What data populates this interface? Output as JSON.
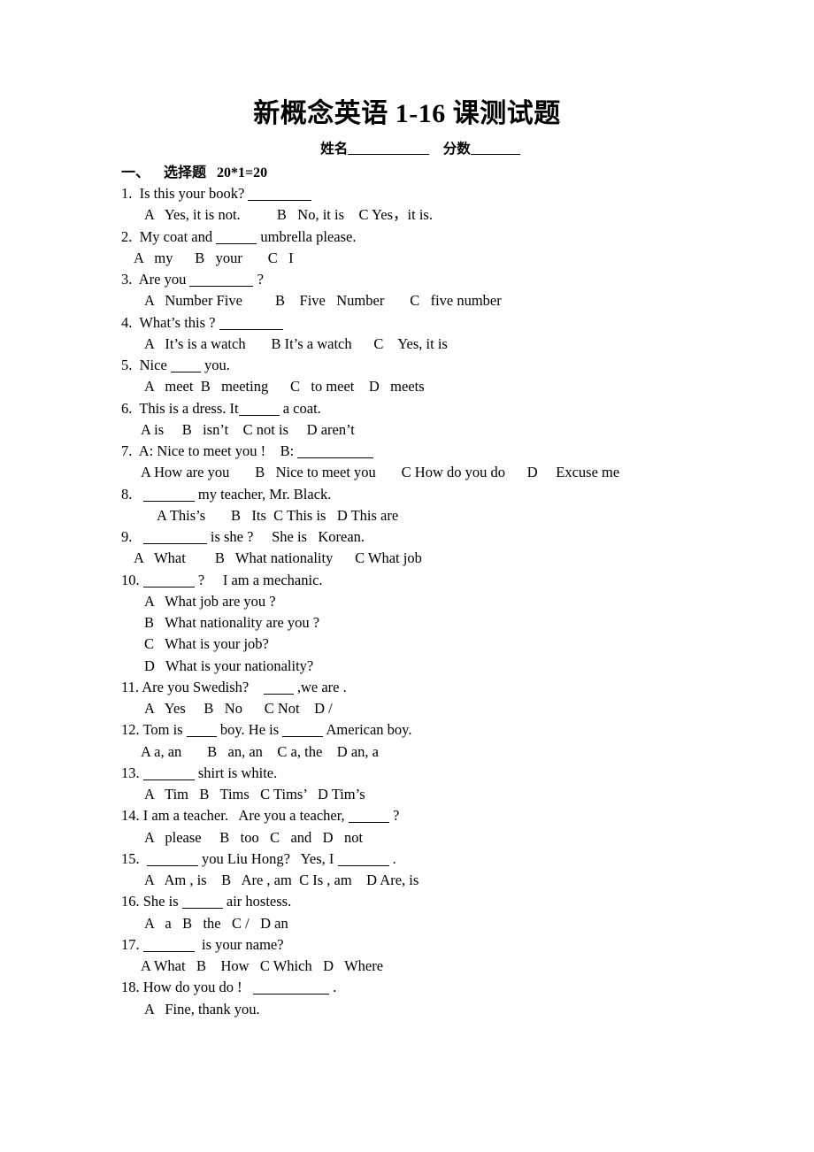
{
  "document": {
    "title": "新概念英语 1-16 课测试题",
    "header_fields": {
      "name_label": "姓名",
      "score_label": "分数"
    },
    "section": {
      "number": "一、",
      "label": "选择题",
      "points": "20*1=20"
    }
  },
  "questions": [
    {
      "num": "1.",
      "stem_parts": [
        "Is this your book?",
        "  "
      ],
      "stem_text": "1.  Is this your book?",
      "blank": "b-xl",
      "options_line": "A   Yes, it is not.          B   No, it is    C Yes，it is.",
      "indent": "ind-26"
    },
    {
      "num": "2.",
      "stem_pre": "2.  My coat and ",
      "stem_post": " umbrella please.",
      "blank": "b-m",
      "options_line": "A   my      B   your       C   I",
      "indent": "ind-14"
    },
    {
      "num": "3.",
      "stem_pre": "3.  Are you ",
      "stem_post": " ?",
      "blank": "b-xl",
      "options_line": "A   Number Five         B    Five   Number       C   five number",
      "indent": "ind-26"
    },
    {
      "num": "4.",
      "stem_pre": "4.  What’s this ? ",
      "stem_post": "",
      "blank": "b-xl",
      "options_line": "A   It’s is a watch       B It’s a watch      C    Yes, it is",
      "indent": "ind-26"
    },
    {
      "num": "5.",
      "stem_pre": "5.  Nice ",
      "stem_post": " you.",
      "blank": "b-s",
      "options_line": "A   meet  B   meeting      C   to meet    D   meets",
      "indent": "ind-26"
    },
    {
      "num": "6.",
      "stem_pre": "6.  This is a dress. It",
      "stem_post": " a coat.",
      "blank": "b-m",
      "options_line": "A is     B   isn’t    C not is     D aren’t",
      "indent": "ind-22"
    },
    {
      "num": "7.",
      "stem_pre": "7.  A: Nice to meet you !    B: ",
      "stem_post": "",
      "blank": "b-xxl",
      "options_line": "A How are you       B   Nice to meet you       C How do you do      D     Excuse me",
      "indent": "ind-22"
    },
    {
      "num": "8.",
      "stem_pre": "8.   ",
      "stem_post": " my teacher, Mr. Black.",
      "blank": "b-l",
      "options_line": "A This’s       B   Its  C This is   D This are",
      "indent": "ind-40"
    },
    {
      "num": "9.",
      "stem_pre": "9.   ",
      "stem_post": " is she ?     She is   Korean.",
      "blank": "b-xl",
      "options_line": "A   What        B   What nationality      C What job",
      "indent": "ind-14"
    },
    {
      "num": "10.",
      "stem_pre": "10. ",
      "stem_post": " ?     I am a mechanic.",
      "blank": "b-l",
      "options_multi": [
        "A   What job are you ?",
        "B   What nationality are you ?",
        "C   What is your job?",
        "D   What is your nationality?"
      ],
      "indent": "ind-26"
    },
    {
      "num": "11.",
      "stem_pre": "11. Are you Swedish?    ",
      "stem_post": " ,we are .",
      "blank": "b-s",
      "options_line": "A   Yes     B   No      C Not    D /",
      "indent": "ind-26"
    },
    {
      "num": "12.",
      "stem_pre": "12. Tom is ",
      "stem_mid": " boy. He is ",
      "stem_post": " American boy.",
      "blank": "b-s",
      "blank2": "b-m",
      "options_line": "A a, an       B   an, an    C a, the    D an, a",
      "indent": "ind-22"
    },
    {
      "num": "13.",
      "stem_pre": "13. ",
      "stem_post": " shirt is white.",
      "blank": "b-l",
      "options_line": "A   Tim   B   Tims   C Tims’   D Tim’s",
      "indent": "ind-26"
    },
    {
      "num": "14.",
      "stem_pre": "14. I am a teacher.   Are you a teacher, ",
      "stem_post": " ?",
      "blank": "b-m",
      "options_line": "A   please     B   too   C   and   D   not",
      "indent": "ind-26"
    },
    {
      "num": "15.",
      "stem_pre": "15.  ",
      "stem_post": " you Liu Hong?   Yes, I ",
      "stem_tail": " .",
      "blank": "b-l",
      "blank2": "b-l",
      "options_line": "A   Am , is    B   Are , am  C Is , am    D Are, is",
      "indent": "ind-26"
    },
    {
      "num": "16.",
      "stem_pre": "16. She is ",
      "stem_post": " air hostess.",
      "blank": "b-m",
      "options_line": "A   a   B   the   C /   D an",
      "indent": "ind-26"
    },
    {
      "num": "17.",
      "stem_pre": "17. ",
      "stem_post": "  is your name?",
      "blank": "b-l",
      "options_line": "A What   B    How   C Which   D   Where",
      "indent": "ind-22"
    },
    {
      "num": "18.",
      "stem_pre": "18. How do you do !   ",
      "stem_post": " .",
      "blank": "b-xxl",
      "options_line": "A   Fine, thank you.",
      "indent": "ind-26"
    }
  ]
}
